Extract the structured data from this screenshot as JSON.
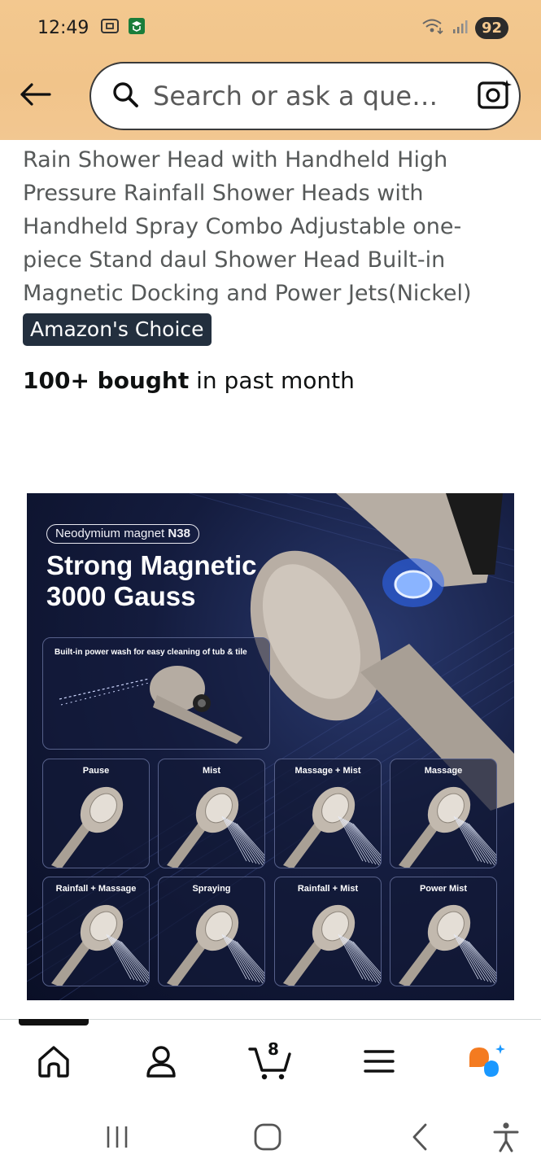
{
  "status_bar": {
    "time": "12:49",
    "battery": "92"
  },
  "search": {
    "placeholder": "Search or ask a que…"
  },
  "product": {
    "title": "Rain Shower Head with Handheld High Pressure Rainfall Shower Heads with Handheld Spray Combo Adjustable one-piece Stand daul Shower Head Built-in Magnetic Docking and Power Jets(Nickel)",
    "badge": "Amazon's Choice",
    "bought_bold": "100+ bought",
    "bought_rest": " in past month"
  },
  "image": {
    "pill_prefix": "Neodymium magnet ",
    "pill_bold": "N38",
    "headline_line1": "Strong Magnetic",
    "headline_line2": "3000 Gauss",
    "feature_caption": "Built-in power wash for easy cleaning of tub & tile",
    "modes": [
      "Pause",
      "Mist",
      "Massage + Mist",
      "Massage",
      "Rainfall + Massage",
      "Spraying",
      "Rainfall + Mist",
      "Power Mist"
    ]
  },
  "bottom_nav": {
    "items": [
      "home-icon",
      "account-icon",
      "cart-icon",
      "menu-icon",
      "rufus-icon"
    ],
    "cart_count": "8"
  },
  "colors": {
    "header_bg": "#f3c88f",
    "badge_bg": "#232f3e",
    "title_text": "#565959",
    "rufus_orange": "#f47b20",
    "rufus_blue": "#1a98ff"
  }
}
